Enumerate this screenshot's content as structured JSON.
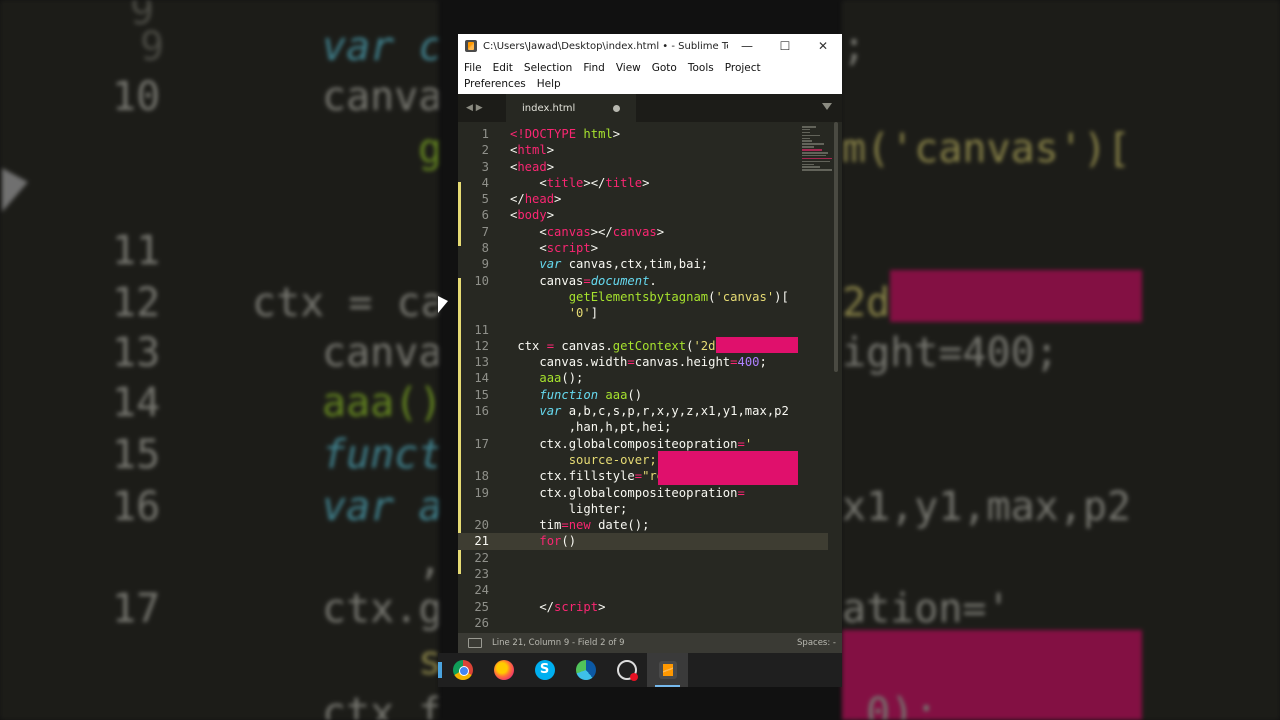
{
  "window": {
    "title": "C:\\Users\\Jawad\\Desktop\\index.html • - Sublime Tex...",
    "minimize": "—",
    "maximize": "☐",
    "close": "✕"
  },
  "menu": [
    "File",
    "Edit",
    "Selection",
    "Find",
    "View",
    "Goto",
    "Tools",
    "Project",
    "Preferences",
    "Help"
  ],
  "tabs": [
    {
      "label": "index.html",
      "modified": true
    }
  ],
  "status": {
    "text": "Line 21, Column 9 - Field 2 of 9",
    "spaces": "Spaces: -"
  },
  "code_lines": [
    {
      "num": "1",
      "html": "<span class='t-tag'>&lt;!</span><span class='t-tag'>DOCTYPE</span> <span class='t-fn'>html</span>&gt;"
    },
    {
      "num": "2",
      "html": "&lt;<span class='t-tag'>html</span>&gt;"
    },
    {
      "num": "3",
      "html": "&lt;<span class='t-tag'>head</span>&gt;"
    },
    {
      "num": "4",
      "html": "    &lt;<span class='t-tag'>title</span>&gt;&lt;/<span class='t-tag'>title</span>&gt;"
    },
    {
      "num": "5",
      "html": "&lt;/<span class='t-tag'>head</span>&gt;"
    },
    {
      "num": "6",
      "html": "&lt;<span class='t-tag'>body</span>&gt;"
    },
    {
      "num": "7",
      "html": "    &lt;<span class='t-tag'>canvas</span>&gt;&lt;/<span class='t-tag'>canvas</span>&gt;"
    },
    {
      "num": "8",
      "html": "    &lt;<span class='t-tag'>script</span>&gt;"
    },
    {
      "num": "9",
      "html": "    <span class='t-kw'>var</span> canvas,ctx,tim,bai;"
    },
    {
      "num": "10",
      "html": "    canvas<span class='t-op'>=</span><span class='t-doc'>document</span>."
    },
    {
      "num": "",
      "html": "        <span class='t-fn'>getElementsbytagnam</span>(<span class='t-str'>'canvas'</span>)["
    },
    {
      "num": "",
      "html": "        <span class='t-str'>'0'</span>]"
    },
    {
      "num": "11",
      "html": ""
    },
    {
      "num": "12",
      "html": " ctx <span class='t-op'>=</span> canvas.<span class='t-fn'>getContext</span>(<span class='t-str'>'2d</span>"
    },
    {
      "num": "13",
      "html": "    canvas.width<span class='t-op'>=</span>canvas.height<span class='t-op'>=</span><span class='t-num'>400</span>;"
    },
    {
      "num": "14",
      "html": "    <span class='t-fn'>aaa</span>();"
    },
    {
      "num": "15",
      "html": "    <span class='t-kw'>function</span> <span class='t-fn'>aaa</span>()"
    },
    {
      "num": "16",
      "html": "    <span class='t-kw'>var</span> a,b,c,s,p,r,x,y,z,x1,y1,max,p2"
    },
    {
      "num": "",
      "html": "        ,han,h,pt,hei;"
    },
    {
      "num": "17",
      "html": "    ctx.globalcompositeopration<span class='t-op'>=</span><span class='t-str'>'</span>"
    },
    {
      "num": "",
      "html": "        <span class='t-str'>source-over;</span>"
    },
    {
      "num": "18",
      "html": "    ctx.fillstyle<span class='t-op'>=</span><span class='t-str'>\"rgb(0,0,0);</span>"
    },
    {
      "num": "19",
      "html": "    ctx.globalcompositeopration<span class='t-op'>=</span>"
    },
    {
      "num": "",
      "html": "        lighter;"
    },
    {
      "num": "20",
      "html": "    tim<span class='t-op'>=</span><span class='t-op'>new</span> date();"
    },
    {
      "num": "21",
      "html": "    <span class='t-op'>for</span>()"
    },
    {
      "num": "22",
      "html": ""
    },
    {
      "num": "23",
      "html": ""
    },
    {
      "num": "24",
      "html": ""
    },
    {
      "num": "25",
      "html": "    &lt;/<span class='t-tag'>script</span>&gt;"
    },
    {
      "num": "26",
      "html": ""
    },
    {
      "num": "27",
      "html": "&lt;/<span class='t-tag'>body</span>&gt;"
    }
  ],
  "background": {
    "left_lines": [
      {
        "num": "9",
        "code": "var c"
      },
      {
        "num": "10",
        "code": "canva"
      },
      {
        "num": "",
        "code": "g"
      },
      {
        "num": "11",
        "code": ""
      },
      {
        "num": "12",
        "code": "ctx = ca"
      },
      {
        "num": "13",
        "code": "canva"
      },
      {
        "num": "14",
        "code": "aaa()"
      },
      {
        "num": "15",
        "code": "funct"
      },
      {
        "num": "16",
        "code": "var a"
      },
      {
        "num": "",
        "code": ","
      },
      {
        "num": "17",
        "code": "ctx.g"
      },
      {
        "num": "",
        "code": "s"
      },
      {
        "num": "18",
        "code": "ctx.f"
      }
    ],
    "right_lines": [
      {
        "code": ";"
      },
      {
        "code": "m('canvas')["
      },
      {
        "code": "2d"
      },
      {
        "code": "ight=400;"
      },
      {
        "code": "x1,y1,max,p2"
      },
      {
        "code": "ation='"
      },
      {
        "code": ",0);"
      }
    ]
  },
  "taskbar": {
    "apps": [
      {
        "name": "chrome-icon"
      },
      {
        "name": "firefox-icon"
      },
      {
        "name": "skype-icon",
        "label": "S"
      },
      {
        "name": "edge-icon"
      },
      {
        "name": "obs-icon"
      },
      {
        "name": "sublime-icon"
      }
    ]
  }
}
